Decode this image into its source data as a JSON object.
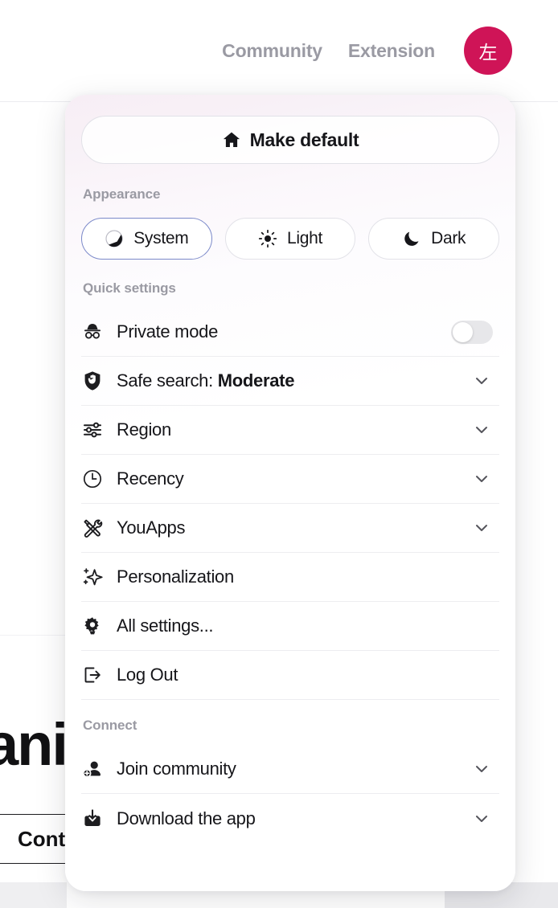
{
  "header": {
    "nav": [
      {
        "label": "Community",
        "name": "nav-link-community"
      },
      {
        "label": "Extension",
        "name": "nav-link-extension"
      }
    ],
    "avatar_initial": "左",
    "avatar_color": "#cf1457"
  },
  "background": {
    "heading_fragment": "ani",
    "card_text": "Cont"
  },
  "panel": {
    "make_default": {
      "label": "Make default",
      "icon": "home-icon"
    },
    "appearance": {
      "section_label": "Appearance",
      "selected": "System",
      "options": [
        {
          "label": "System",
          "icon": "half-circle-icon",
          "selected": true
        },
        {
          "label": "Light",
          "icon": "sun-icon",
          "selected": false
        },
        {
          "label": "Dark",
          "icon": "moon-icon",
          "selected": false
        }
      ]
    },
    "quick_settings": {
      "section_label": "Quick settings",
      "items": [
        {
          "label": "Private mode",
          "icon": "incognito-icon",
          "control": "toggle",
          "toggle_on": false
        },
        {
          "label": "Safe search: ",
          "value": "Moderate",
          "icon": "shield-hand-icon",
          "control": "chevron"
        },
        {
          "label": "Region",
          "icon": "sliders-icon",
          "control": "chevron"
        },
        {
          "label": "Recency",
          "icon": "clock-icon",
          "control": "chevron"
        },
        {
          "label": "YouApps",
          "icon": "tools-icon",
          "control": "chevron"
        },
        {
          "label": "Personalization",
          "icon": "sparkles-icon",
          "control": "none"
        },
        {
          "label": "All settings...",
          "icon": "gear-icon",
          "control": "none"
        },
        {
          "label": "Log Out",
          "icon": "logout-icon",
          "control": "none"
        }
      ]
    },
    "connect": {
      "section_label": "Connect",
      "items": [
        {
          "label": "Join community",
          "icon": "person-add-icon",
          "control": "chevron"
        },
        {
          "label": "Download the app",
          "icon": "download-icon",
          "control": "chevron"
        }
      ]
    }
  },
  "colors": {
    "accent": "#cf1457",
    "selected_border": "#7b89c9",
    "muted_text": "#9a9aa3",
    "body_text": "#16161a"
  }
}
